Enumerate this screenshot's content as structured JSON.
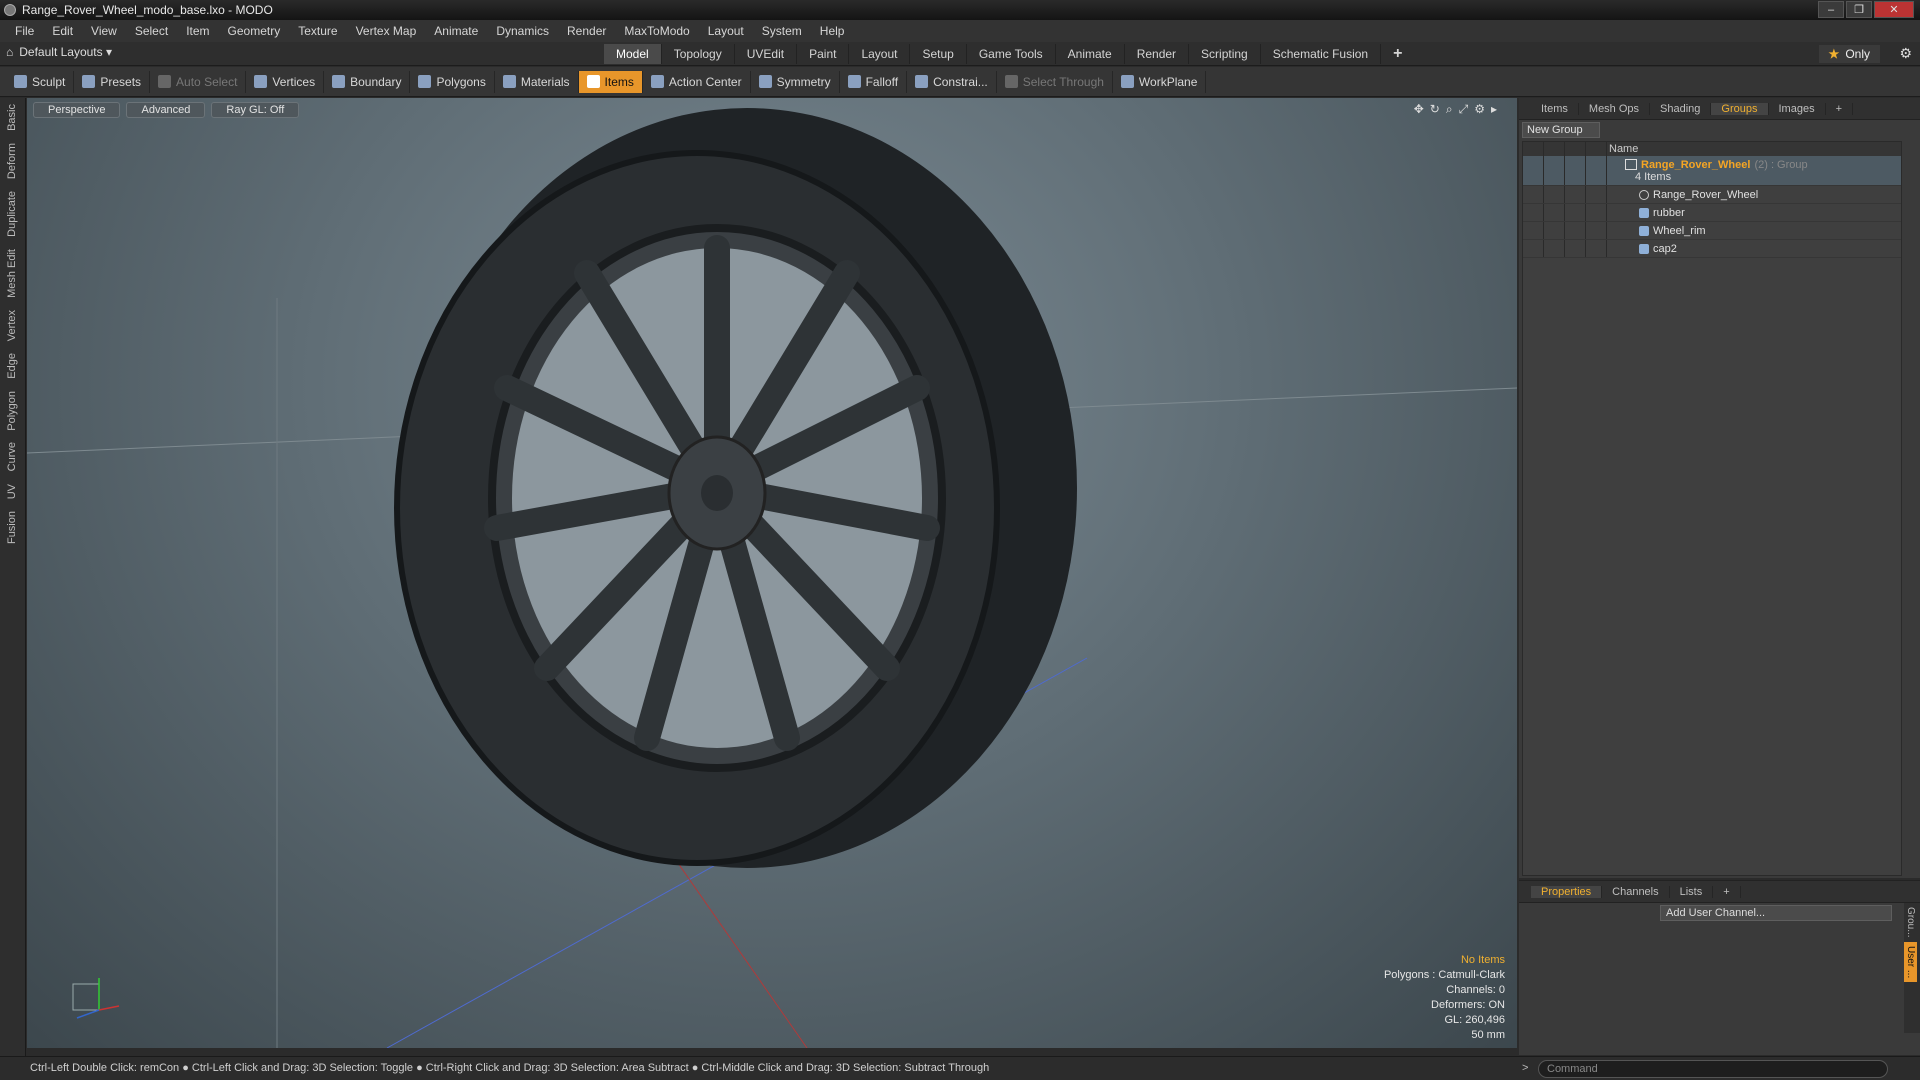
{
  "window": {
    "title": "Range_Rover_Wheel_modo_base.lxo - MODO",
    "controls": [
      "–",
      "❐",
      "✕"
    ]
  },
  "menu": [
    "File",
    "Edit",
    "View",
    "Select",
    "Item",
    "Geometry",
    "Texture",
    "Vertex Map",
    "Animate",
    "Dynamics",
    "Render",
    "MaxToModo",
    "Layout",
    "System",
    "Help"
  ],
  "layout": {
    "label": "Default Layouts ▾",
    "icon": "home-icon"
  },
  "tabs": [
    {
      "label": "Model",
      "active": true
    },
    {
      "label": "Topology"
    },
    {
      "label": "UVEdit"
    },
    {
      "label": "Paint"
    },
    {
      "label": "Layout"
    },
    {
      "label": "Setup"
    },
    {
      "label": "Game Tools"
    },
    {
      "label": "Animate"
    },
    {
      "label": "Render"
    },
    {
      "label": "Scripting"
    },
    {
      "label": "Schematic Fusion"
    },
    {
      "label": "+",
      "plus": true
    }
  ],
  "only_label": "Only",
  "toolbar": [
    {
      "label": "Sculpt"
    },
    {
      "label": "Presets"
    },
    {
      "label": "Auto Select",
      "dim": true
    },
    {
      "label": "Vertices"
    },
    {
      "label": "Boundary"
    },
    {
      "label": "Polygons"
    },
    {
      "label": "Materials"
    },
    {
      "label": "Items",
      "active": true
    },
    {
      "label": "Action Center"
    },
    {
      "label": "Symmetry"
    },
    {
      "label": "Falloff"
    },
    {
      "label": "Constrai..."
    },
    {
      "label": "Select Through",
      "dim": true
    },
    {
      "label": "WorkPlane"
    }
  ],
  "left_tabs": [
    "Basic",
    "Deform",
    "Duplicate",
    "Mesh Edit",
    "Vertex",
    "Edge",
    "Polygon",
    "Curve",
    "UV",
    "Fusion"
  ],
  "viewport": {
    "buttons": [
      "Perspective",
      "Advanced",
      "Ray GL: Off"
    ],
    "info": {
      "selection": "No Items",
      "polygons": "Polygons : Catmull-Clark",
      "channels": "Channels: 0",
      "deformers": "Deformers: ON",
      "gl": "GL: 260,496",
      "scale": "50 mm"
    }
  },
  "status_hint": "Ctrl-Left Double Click: remCon ● Ctrl-Left Click and Drag: 3D Selection: Toggle ● Ctrl-Right Click and Drag: 3D Selection: Area Subtract ● Ctrl-Middle Click and Drag: 3D Selection: Subtract Through",
  "command_placeholder": "Command",
  "right_panel": {
    "tabs": [
      {
        "label": "Items"
      },
      {
        "label": "Mesh Ops"
      },
      {
        "label": "Shading"
      },
      {
        "label": "Groups",
        "active": true
      },
      {
        "label": "Images"
      },
      {
        "label": "+"
      }
    ],
    "new_group": "New Group",
    "name_header": "Name",
    "group": {
      "name": "Range_Rover_Wheel",
      "suffix": "(2) : Group",
      "count": "4 Items"
    },
    "items": [
      {
        "label": "Range_Rover_Wheel",
        "icon": "locator-icon"
      },
      {
        "label": "rubber",
        "icon": "mesh-icon"
      },
      {
        "label": "Wheel_rim",
        "icon": "mesh-icon"
      },
      {
        "label": "cap2",
        "icon": "mesh-icon"
      }
    ]
  },
  "prop_panel": {
    "tabs": [
      {
        "label": "Properties",
        "active": true
      },
      {
        "label": "Channels"
      },
      {
        "label": "Lists"
      },
      {
        "label": "+"
      }
    ],
    "add_user": "Add User Channel...",
    "side": [
      "Grou...",
      "User ..."
    ]
  }
}
